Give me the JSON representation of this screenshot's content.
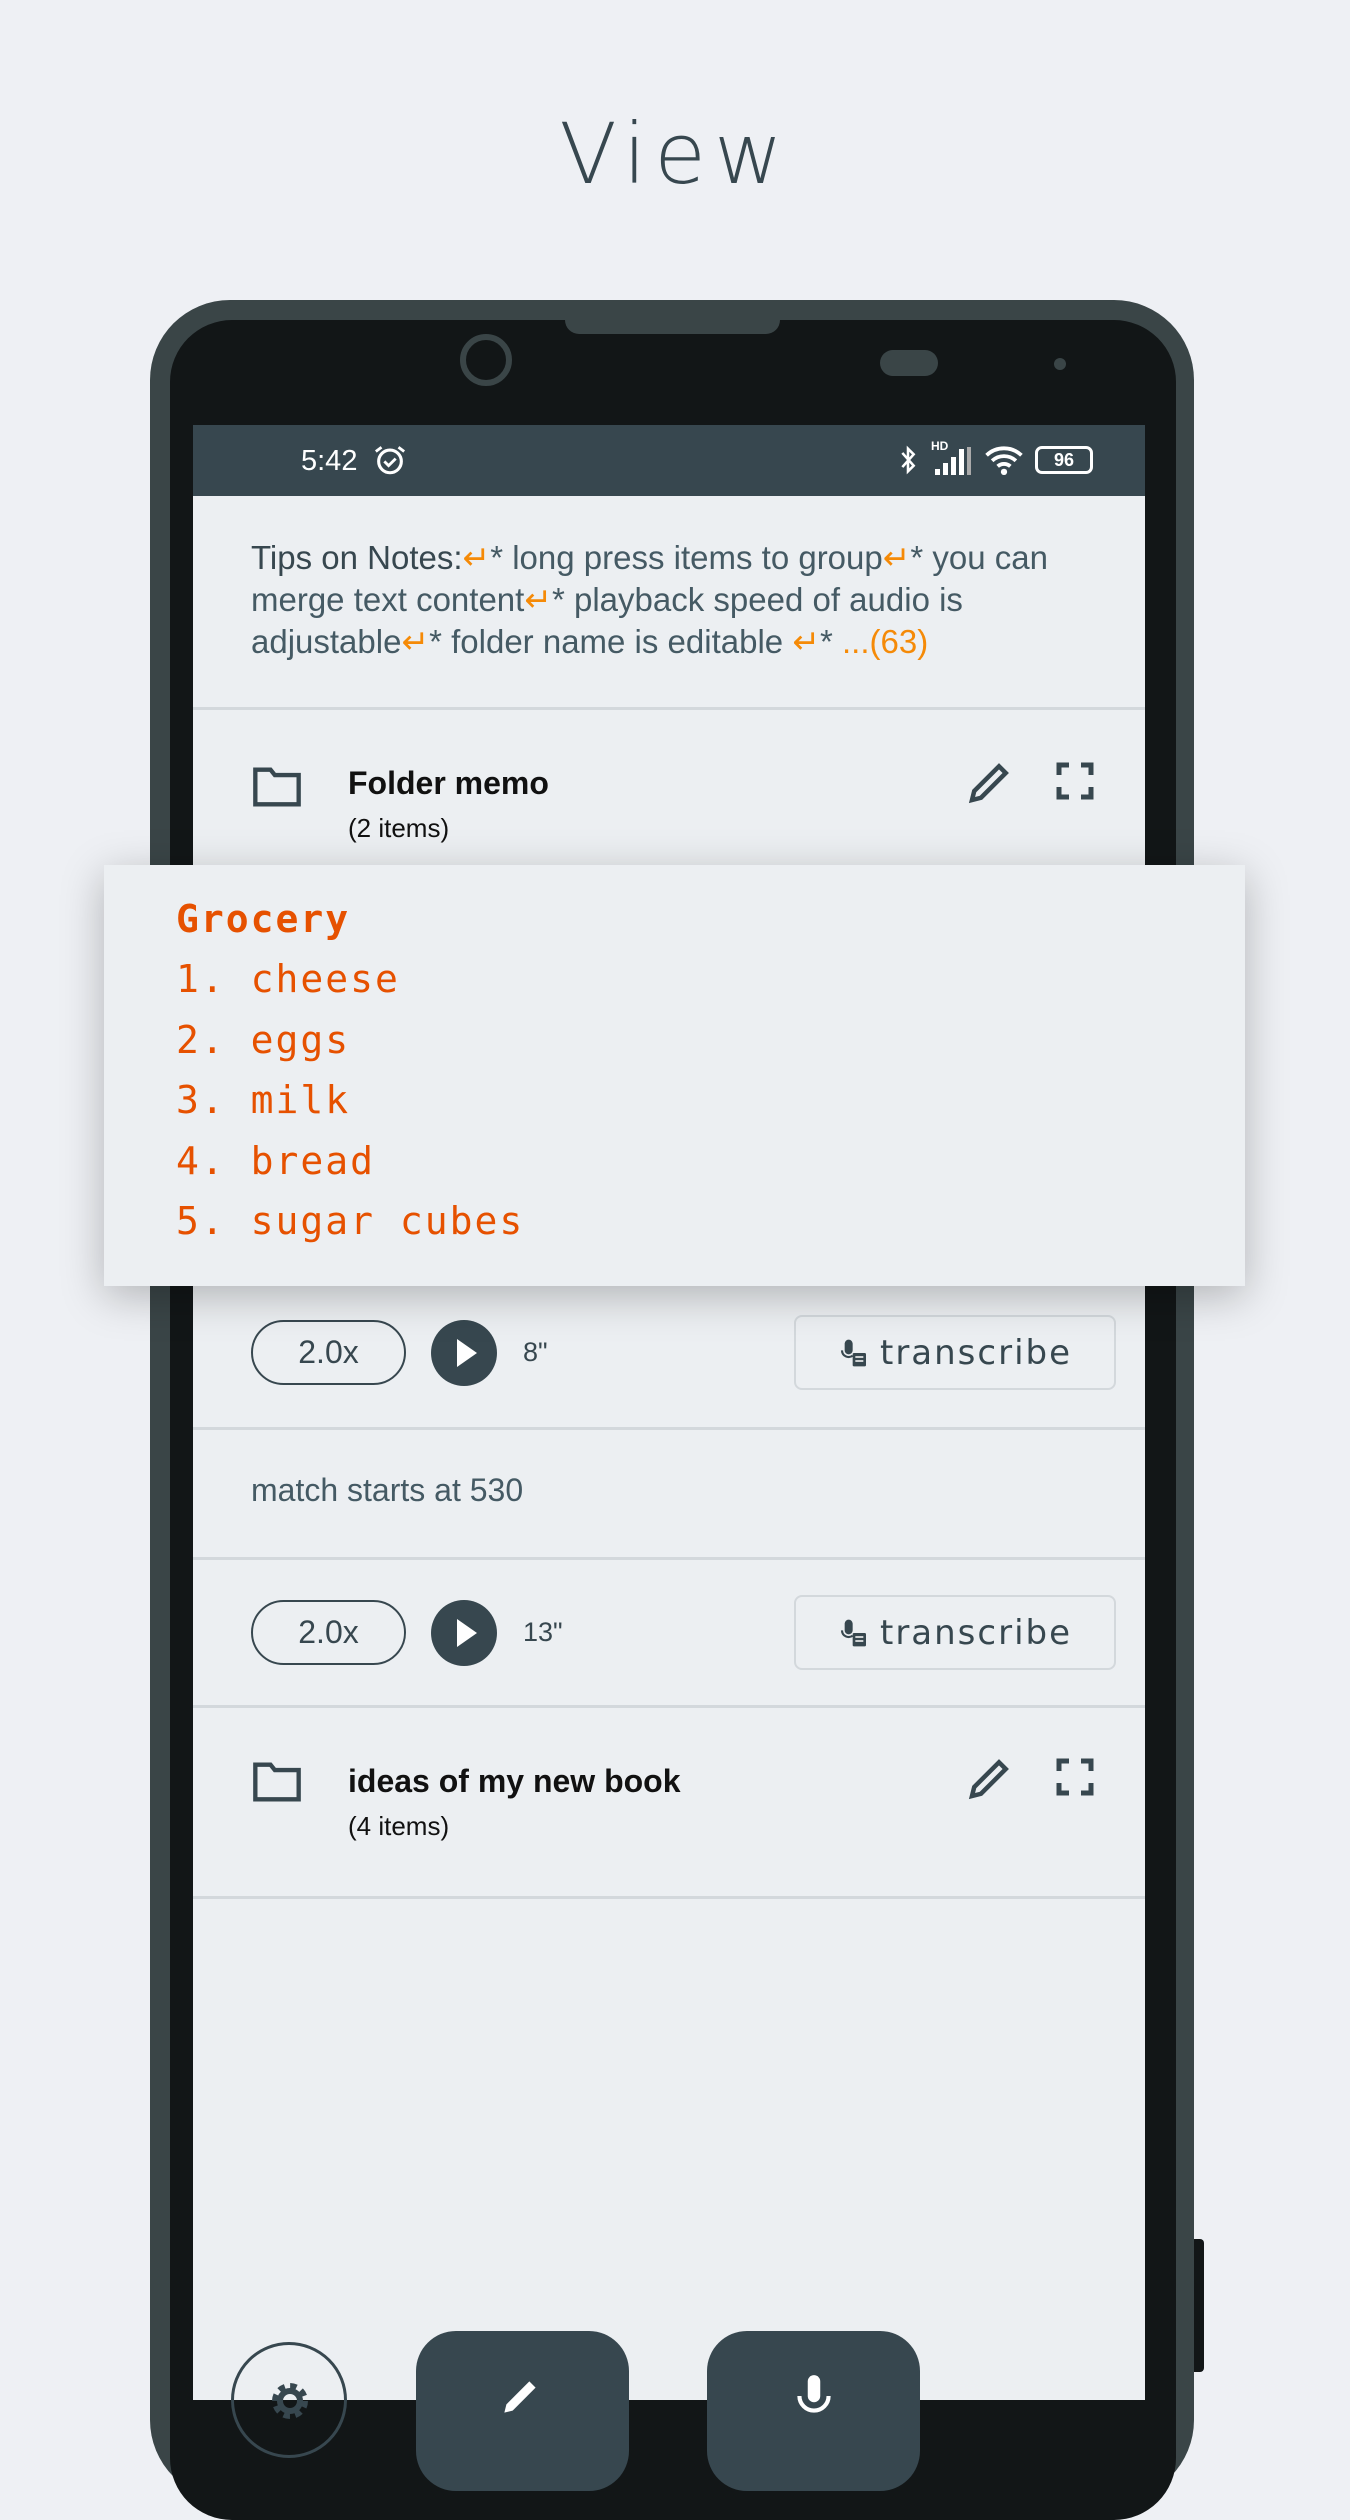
{
  "page_title": "View",
  "status_bar": {
    "time": "5:42",
    "battery": "96",
    "network": "HD"
  },
  "tips": {
    "label": "Tips on Notes:",
    "items": [
      "* long press items to group",
      "* you can merge text content",
      "* playback speed of audio is adjustable",
      "* folder name is editable ",
      "*"
    ],
    "more": "...(63)"
  },
  "folders": [
    {
      "title": "Folder memo",
      "count": "(2 items)"
    },
    {
      "title": "ideas of my new book",
      "count": "(4 items)"
    }
  ],
  "popup": {
    "lines": [
      "Grocery",
      "1. cheese",
      "2. eggs",
      "3. milk",
      "4. bread",
      "5. sugar cubes"
    ]
  },
  "audio": [
    {
      "speed": "2.0x",
      "duration": "8\"",
      "transcribe": "transcribe"
    },
    {
      "speed": "2.0x",
      "duration": "13\"",
      "transcribe": "transcribe"
    }
  ],
  "text_note": "match starts at 530",
  "colors": {
    "accent": "#37474f",
    "grocery": "#e65100",
    "tip_arrow": "#f58a07",
    "background": "#eceff2"
  }
}
